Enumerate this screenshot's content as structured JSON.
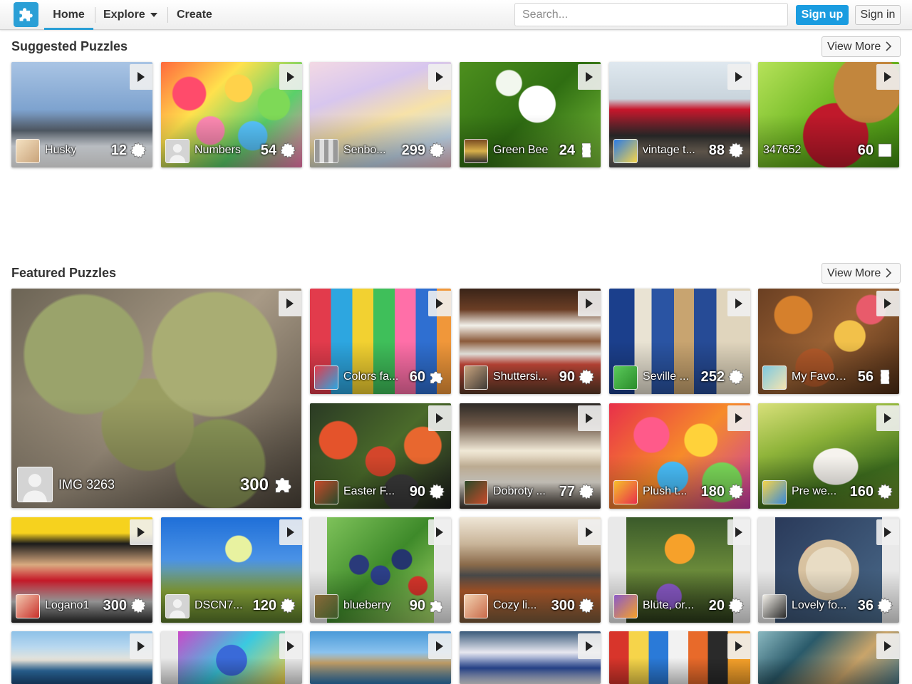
{
  "header": {
    "nav": {
      "home": "Home",
      "explore": "Explore",
      "create": "Create"
    },
    "search_placeholder": "Search...",
    "signup": "Sign up",
    "signin": "Sign in"
  },
  "suggested": {
    "title": "Suggested Puzzles",
    "view_more": "View More",
    "items": [
      {
        "title": "Husky",
        "count": "12",
        "shape": "gear",
        "bg": "linear-gradient(180deg,#a9c4e4 0%,#7ea3cf 45%,#56606c 65%,#e9eef4 80%,#ffffff 100%)",
        "avatar": "linear-gradient(135deg,#f4e1c1,#c9a37a)"
      },
      {
        "title": "Numbers",
        "count": "54",
        "shape": "gear",
        "bg": "radial-gradient(circle at 20% 30%,#ff4b6b 0 12%,transparent 13%),radial-gradient(circle at 55% 25%,#ffd24a 0 12%,transparent 13%),radial-gradient(circle at 80% 40%,#7ed957 0 12%,transparent 13%),radial-gradient(circle at 35% 65%,#ff8ab3 0 12%,transparent 13%),radial-gradient(circle at 65% 70%,#58c7ff 0 12%,transparent 13%),linear-gradient(135deg,#ff6a3d,#ffe14d,#5ad06a,#ff7ab6)",
        "avatar": "default"
      },
      {
        "title": "Senbo...",
        "count": "299",
        "shape": "gear",
        "bg": "linear-gradient(160deg,#f3d9e4 0%,#d7c6ee 30%,#f7e2a8 55%,#c7dcef 80%,#f2c0c9 100%)",
        "avatar": "linear-gradient(90deg,#999 0 20%,#ddd 20% 40%,#999 40% 60%,#ddd 60% 80%,#999 80%)"
      },
      {
        "title": "Green Bee",
        "count": "24",
        "shape": "tile",
        "bg": "radial-gradient(circle at 55% 40%,#ffffff 0 18%,transparent 19%),radial-gradient(circle at 35% 20%,#f2f7ee 0 10%,transparent 11%),linear-gradient(135deg,#4d8f1e,#2f6e12,#7bbf3a)",
        "avatar": "linear-gradient(180deg,#7a4b22,#d8b04a,#2c2c2c)"
      },
      {
        "title": "vintage t...",
        "count": "88",
        "shape": "gear",
        "bg": "linear-gradient(180deg,#dfe8ef 0%,#c9d4dc 35%,#c7162b 45%,#2b2b2b 70%,#7a6e60 85%,#555 100%)",
        "avatar": "linear-gradient(135deg,#2b7be4,#f6d44a)"
      },
      {
        "title": "347652",
        "count": "60",
        "shape": "square",
        "bg": "radial-gradient(circle at 78% 25%,#c2863d 0 25%,transparent 26%),radial-gradient(circle at 55% 70%,#c0192b 0 30%,transparent 31%),linear-gradient(135deg,#b6e25a,#6bb61f,#3f8a12)",
        "avatar": "none"
      }
    ]
  },
  "featured": {
    "title": "Featured Puzzles",
    "view_more": "View More",
    "big": {
      "title": "IMG 3263",
      "count": "300",
      "shape": "piece",
      "bg": "radial-gradient(circle at 25% 30%,#9aa36b 0 22%,transparent 23%),radial-gradient(circle at 70% 30%,#a9ad73 0 24%,transparent 25%),radial-gradient(circle at 47% 62%,#9a9e62 0 22%,transparent 23%),radial-gradient(circle at 72% 80%,#8e9a5a 0 16%,transparent 17%),linear-gradient(135deg,#6c6455,#a89a86,#4c443a)",
      "avatar": "default"
    },
    "items": [
      {
        "title": "Colors fa...",
        "count": "60",
        "shape": "piece",
        "bg": "linear-gradient(90deg,#e23b4c 0 15%,#2da6e0 15% 30%,#f2d131 30% 45%,#3fbf5a 45% 60%,#ff6fa8 60% 75%,#2f6fd1 75% 90%,#f0973a 90%)",
        "avatar": "linear-gradient(135deg,#e23b4c,#2da6e0)"
      },
      {
        "title": "Shuttersi...",
        "count": "90",
        "shape": "gear",
        "bg": "linear-gradient(180deg,#3a2418 0%,#6b3e25 20%,#f2f0ea 35%,#8b5a3a 50%,#f2f0ea 62%,#cf4b3b 72%,#5a3a27 100%)",
        "avatar": "linear-gradient(135deg,#c9a47e,#3f3a36)"
      },
      {
        "title": "Seville ...",
        "count": "252",
        "shape": "gear",
        "bg": "linear-gradient(90deg,#1b3f8c 0 18%,#e9e3d3 18% 30%,#2a54a3 30% 46%,#c8a470 46% 60%,#264b96 60% 76%,#e0d5bd 76%)",
        "avatar": "linear-gradient(135deg,#5ac95a,#2a8c2a)"
      },
      {
        "title": "My Favor...",
        "count": "56",
        "shape": "tile",
        "bg": "radial-gradient(circle at 25% 25%,#d6802c 0 14%,transparent 15%),radial-gradient(circle at 65% 45%,#f2c14a 0 14%,transparent 15%),radial-gradient(circle at 80% 20%,#e85b6b 0 10%,transparent 11%),radial-gradient(circle at 40% 75%,#b35a2a 0 16%,transparent 17%),linear-gradient(135deg,#6a3f22,#9b6234,#4a2a14)",
        "avatar": "linear-gradient(135deg,#7ec9e0,#f6e4b0)"
      },
      {
        "title": "Easter F...",
        "count": "90",
        "shape": "gear",
        "bg": "radial-gradient(circle at 20% 35%,#e4532b 0 14%,transparent 15%),radial-gradient(circle at 50% 55%,#d4462b 0 16%,transparent 17%),radial-gradient(circle at 80% 40%,#e8672f 0 14%,transparent 15%),radial-gradient(circle at 65% 85%,#3a3a3a 0 14%,transparent 15%),linear-gradient(135deg,#2a3a24,#4a6a2a,#1c1c1c)",
        "avatar": "linear-gradient(135deg,#c94a2a,#2a4a2a)"
      },
      {
        "title": "Dobroty ...",
        "count": "77",
        "shape": "gear",
        "bg": "linear-gradient(180deg,#2e2a26 0%,#6d5848 20%,#f0e8d6 45%,#c9b79c 60%,#e7e2d8 75%,#3a322c 100%)",
        "avatar": "linear-gradient(135deg,#2a4a2a,#c94a2a)"
      },
      {
        "title": "Plush t...",
        "count": "180",
        "shape": "gear",
        "bg": "radial-gradient(circle at 30% 30%,#ff5a8a 0 14%,transparent 15%),radial-gradient(circle at 65% 35%,#ffd23a 0 14%,transparent 15%),radial-gradient(circle at 45% 70%,#4ac2ff 0 14%,transparent 15%),radial-gradient(circle at 80% 75%,#7ddc5a 0 14%,transparent 15%),linear-gradient(135deg,#e8304a,#f68b2a,#c93aa8)",
        "avatar": "linear-gradient(135deg,#f6c02a,#e8304a)"
      },
      {
        "title": "Pre we...",
        "count": "160",
        "shape": "gear",
        "bg": "radial-gradient(ellipse at 55% 60%,#f6f3ee 0 20%,transparent 21%),linear-gradient(160deg,#d8e07a 0%,#8fb43a 35%,#3e6e1e 70%,#6a8a2a 100%)",
        "avatar": "linear-gradient(135deg,#f6d44a,#3a8ad8)"
      },
      {
        "title": "Logano1",
        "count": "300",
        "shape": "gear",
        "bg": "linear-gradient(180deg,#f6d21e 0%,#f6d21e 15%,#1b1b1b 25%,#d9aa80 45%,#d21b2b 60%,#b8b8b8 80%,#2a2a2a 100%)",
        "avatar": "linear-gradient(135deg,#f2c9b0,#c9302a)"
      },
      {
        "title": "DSCN7...",
        "count": "120",
        "shape": "gear",
        "bg": "radial-gradient(circle at 55% 30%,#e8f2a0 0 12%,transparent 13%),linear-gradient(180deg,#1f6fd8 0%,#4a92e6 40%,#8aa63a 70%,#5a7a2a 100%)",
        "avatar": "default"
      },
      {
        "title": "blueberry",
        "count": "90",
        "shape": "piece",
        "bg": "radial-gradient(circle at 30% 45%,#2a3a7a 0 10%,transparent 11%),radial-gradient(circle at 50% 55%,#2c3f88 0 12%,transparent 13%),radial-gradient(circle at 70% 40%,#24356e 0 10%,transparent 11%),radial-gradient(circle at 85% 65%,#d8352b 0 8%,transparent 9%),linear-gradient(135deg,#7ec25a,#3e8a2a,#a8d86a)",
        "avatar": "linear-gradient(135deg,#8a6a3a,#3e5a2a)",
        "inset": "photo"
      },
      {
        "title": "Cozy li...",
        "count": "300",
        "shape": "gear",
        "bg": "linear-gradient(180deg,#efe6d6 0%,#c9b59a 25%,#8a6a4a 45%,#4a4a4a 55%,#b05a2a 70%,#7a5a3a 100%)",
        "avatar": "linear-gradient(135deg,#f2d2b0,#c96a4a)"
      },
      {
        "title": "Blüte, or...",
        "count": "20",
        "shape": "gear",
        "bg": "radial-gradient(circle at 50% 30%,#f6a12a 0 16%,transparent 17%),radial-gradient(circle at 40% 75%,#8a5ac9 0 12%,transparent 13%),linear-gradient(180deg,#3a5a2a,#6a8a3a,#2a3a1a)",
        "avatar": "linear-gradient(135deg,#8a5ac9,#f6a12a)",
        "inset": "photo"
      },
      {
        "title": "Lovely fo...",
        "count": "36",
        "shape": "gear",
        "bg": "radial-gradient(circle at 50% 50%,#e8dcc4 0 30%,#d8c2a0 31% 40%,transparent 41%),radial-gradient(circle at 35% 35%,#d8352b 0 8%,transparent 9%),linear-gradient(135deg,#2a3a5a,#4a6a8a)",
        "avatar": "linear-gradient(135deg,#f2efe8,#2a2a2a)",
        "inset": "photo"
      }
    ],
    "row4": [
      {
        "bg": "linear-gradient(180deg,#8ec1e8 0%,#b8d8ef 30%,#e8e4da 55%,#2e6fa6 75%,#1d4e80 100%)"
      },
      {
        "bg": "radial-gradient(circle at 50% 55%,#3a6ad8 0 25%,transparent 26%),linear-gradient(135deg,#c94ac9,#3ac9e0,#f6d44a)",
        "inset": "photo"
      },
      {
        "bg": "linear-gradient(180deg,#4a9ad8 0%,#8ac2ee 40%,#c9a46a 60%,#2e7ab8 100%)"
      },
      {
        "bg": "linear-gradient(180deg,#3a5a7a 0%,#e8e8f0 40%,#2a4a9a 70%,#f2f2f6 100%)"
      },
      {
        "bg": "linear-gradient(90deg,#d8352b 0 14%,#f6d44a 14% 28%,#2a7ad8 28% 42%,#f2f2f2 42% 56%,#e86a2a 56% 70%,#2a2a2a 70% 84%,#f6a12a 84%)"
      },
      {
        "bg": "linear-gradient(135deg,#8ab8c0,#2a5a6a,#c9a46a,#4a7a8a)"
      }
    ]
  }
}
